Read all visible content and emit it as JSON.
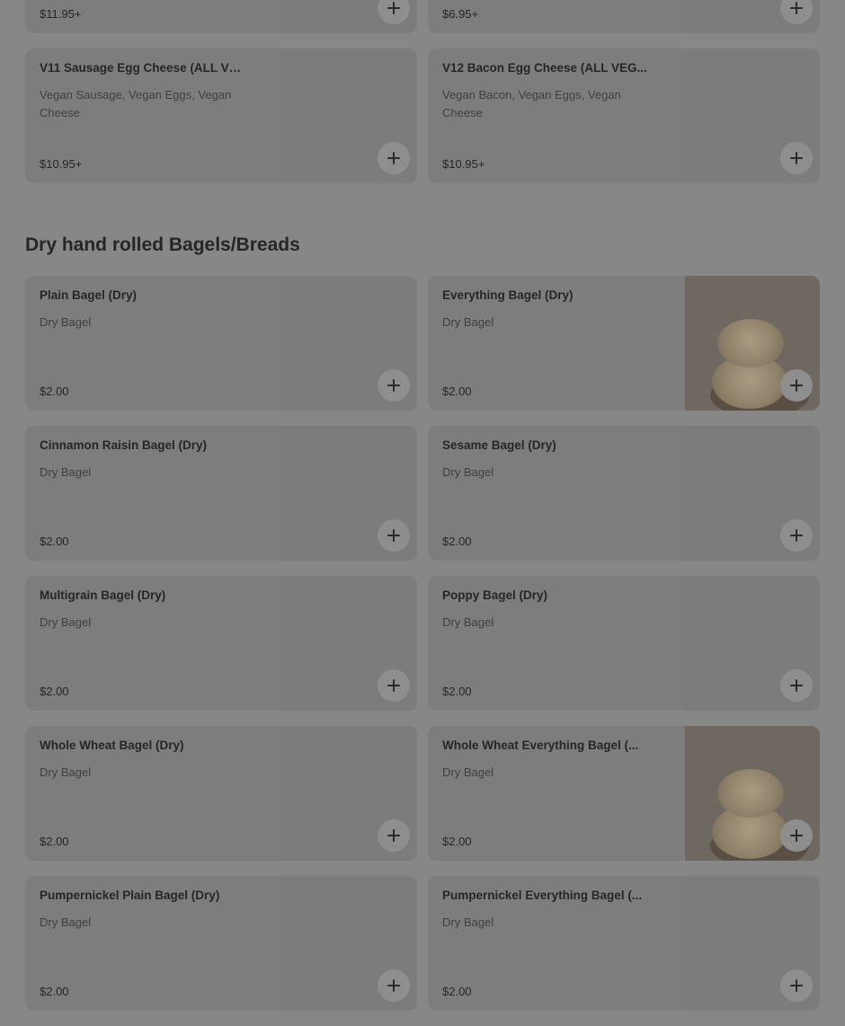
{
  "colors": {
    "page_bg": "#878787",
    "card_bg": "#7d7d7d",
    "text_dark": "#262626",
    "text_muted": "#404040",
    "add_button_bg": "#8e8e8e"
  },
  "top_partial": [
    {
      "price": "$11.95+"
    },
    {
      "price": "$6.95+"
    }
  ],
  "vegan_items": [
    {
      "name": "V11 Sausage Egg Cheese (ALL VE...",
      "description": "Vegan Sausage, Vegan Eggs, Vegan Cheese",
      "price": "$10.95+"
    },
    {
      "name": "V12 Bacon Egg Cheese (ALL VEG...",
      "description": "Vegan Bacon, Vegan Eggs, Vegan Cheese",
      "price": "$10.95+"
    }
  ],
  "section": {
    "title": "Dry hand rolled Bagels/Breads",
    "items": [
      {
        "name": "Plain Bagel (Dry)",
        "description": "Dry Bagel",
        "price": "$2.00"
      },
      {
        "name": "Everything Bagel (Dry)",
        "description": "Dry Bagel",
        "price": "$2.00"
      },
      {
        "name": "Cinnamon Raisin Bagel (Dry)",
        "description": "Dry Bagel",
        "price": "$2.00"
      },
      {
        "name": "Sesame Bagel (Dry)",
        "description": "Dry Bagel",
        "price": "$2.00"
      },
      {
        "name": "Multigrain Bagel (Dry)",
        "description": "Dry Bagel",
        "price": "$2.00"
      },
      {
        "name": "Poppy Bagel (Dry)",
        "description": "Dry Bagel",
        "price": "$2.00"
      },
      {
        "name": "Whole Wheat Bagel (Dry)",
        "description": "Dry Bagel",
        "price": "$2.00"
      },
      {
        "name": "Whole Wheat Everything Bagel (...",
        "description": "Dry Bagel",
        "price": "$2.00"
      },
      {
        "name": "Pumpernickel Plain Bagel (Dry)",
        "description": "Dry Bagel",
        "price": "$2.00"
      },
      {
        "name": "Pumpernickel Everything Bagel (...",
        "description": "Dry Bagel",
        "price": "$2.00"
      }
    ]
  },
  "icons": {
    "add": "plus-icon",
    "photo": "bagel-photo"
  }
}
